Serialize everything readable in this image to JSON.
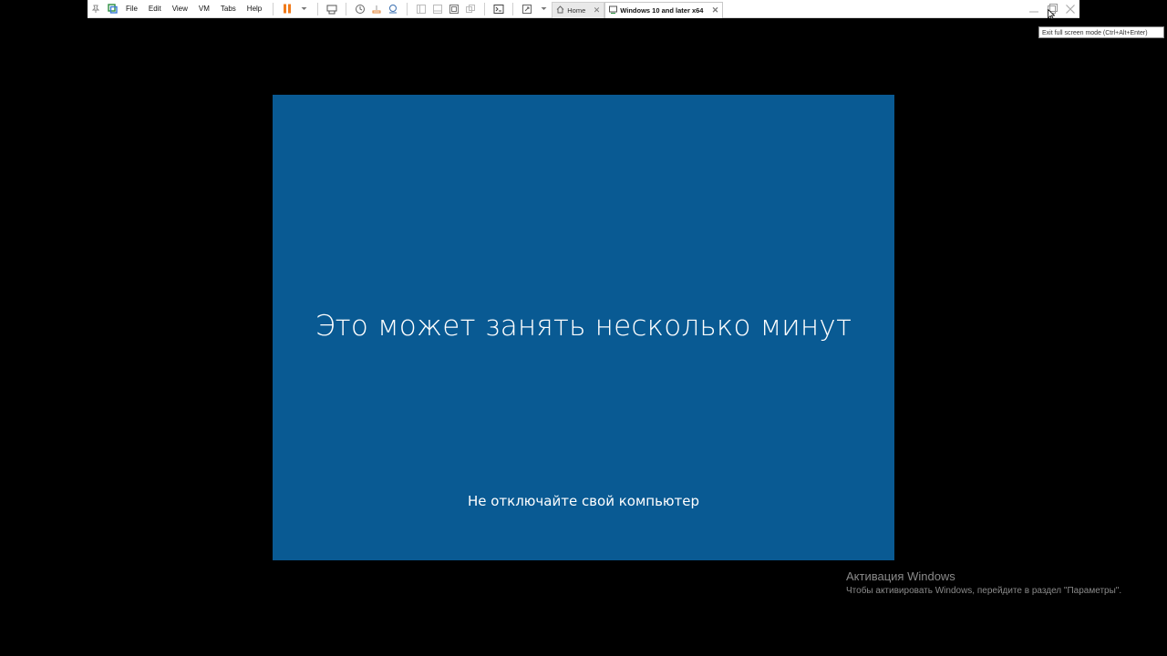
{
  "toolbar": {
    "menu": {
      "file": "File",
      "edit": "Edit",
      "view": "View",
      "vm": "VM",
      "tabs": "Tabs",
      "help": "Help"
    },
    "tabs": {
      "home": "Home",
      "active": "Windows 10 and later x64"
    },
    "tooltip": "Exit full screen mode (Ctrl+Alt+Enter)",
    "colors": {
      "pause_accent": "#f07a1a",
      "toolbar_bg": "#ffffff"
    }
  },
  "vm": {
    "title": "Это может занять несколько минут",
    "subtitle": "Не отключайте свой компьютер",
    "background": "#095a93"
  },
  "activation": {
    "title": "Активация Windows",
    "text": "Чтобы активировать Windows, перейдите в раздел \"Параметры\"."
  }
}
